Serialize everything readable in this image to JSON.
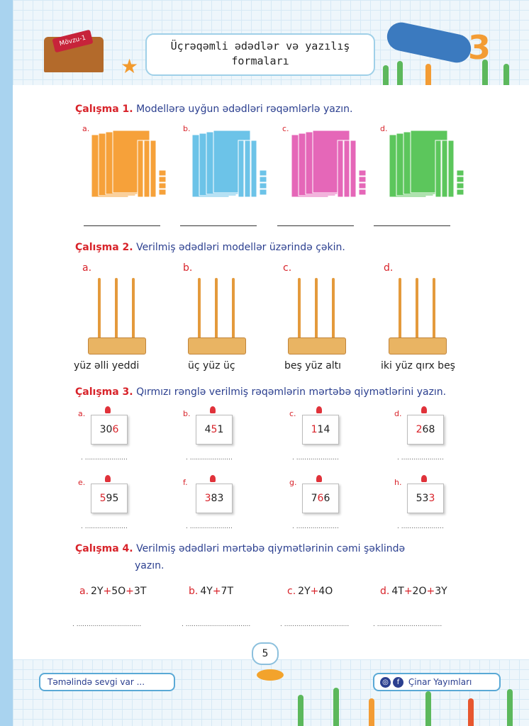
{
  "header": {
    "badge": "Mövzu-1",
    "title_line1": "Üçrəqəmli ədədlər və yazılış",
    "title_line2": "formaları"
  },
  "exercises": {
    "ex1": {
      "label": "Çalışma 1.",
      "text": "Modellərə uyğun ədədləri rəqəmlərlə yazın.",
      "items": [
        {
          "letter": "a.",
          "color": "#f6a13a"
        },
        {
          "letter": "b.",
          "color": "#6cc3e8"
        },
        {
          "letter": "c.",
          "color": "#e567b8"
        },
        {
          "letter": "d.",
          "color": "#5cc65c"
        }
      ]
    },
    "ex2": {
      "label": "Çalışma 2.",
      "text": "Verilmiş ədədləri modellər üzərində çəkin.",
      "items": [
        {
          "letter": "a.",
          "words": "yüz əlli yeddi"
        },
        {
          "letter": "b.",
          "words": "üç yüz üç"
        },
        {
          "letter": "c.",
          "words": "beş yüz altı"
        },
        {
          "letter": "d.",
          "words": "iki yüz qırx beş"
        }
      ]
    },
    "ex3": {
      "label": "Çalışma 3.",
      "text": "Qırmızı rənglə verilmiş rəqəmlərin mərtəbə qiymətlərini yazın.",
      "items": [
        {
          "letter": "a.",
          "pre": "30",
          "red": "6",
          "post": "",
          "dots": ". ....................."
        },
        {
          "letter": "b.",
          "pre": "4",
          "red": "5",
          "post": "1",
          "dots": ". ....................."
        },
        {
          "letter": "c.",
          "pre": "",
          "red": "1",
          "post": "14",
          "dots": ". ....................."
        },
        {
          "letter": "d.",
          "pre": "",
          "red": "2",
          "post": "68",
          "dots": ". ....................."
        },
        {
          "letter": "e.",
          "pre": "",
          "red": "5",
          "post": "95",
          "dots": ". ....................."
        },
        {
          "letter": "f.",
          "pre": "",
          "red": "3",
          "post": "83",
          "dots": ". ....................."
        },
        {
          "letter": "g.",
          "pre": "7",
          "red": "6",
          "post": "6",
          "dots": ". ....................."
        },
        {
          "letter": "h.",
          "pre": "53",
          "red": "3",
          "post": "",
          "dots": ". ....................."
        }
      ]
    },
    "ex4": {
      "label": "Çalışma 4.",
      "text_line1": "Verilmiş ədədləri mərtəbə qiymətlərinin cəmi şəklində",
      "text_line2": "yazın.",
      "items": [
        {
          "letter": "a.",
          "p1": "2Y",
          "op1": "+",
          "p2": "5O",
          "op2": "+",
          "p3": "3T",
          "dots": ". ................................"
        },
        {
          "letter": "b.",
          "p1": "4Y",
          "op1": "+",
          "p2": "7T",
          "op2": "",
          "p3": "",
          "dots": ". ................................"
        },
        {
          "letter": "c.",
          "p1": "2Y",
          "op1": "+",
          "p2": "4O",
          "op2": "",
          "p3": "",
          "dots": ". ................................"
        },
        {
          "letter": "d.",
          "p1": "4T",
          "op1": "+",
          "p2": "2O",
          "op2": "+",
          "p3": "3Y",
          "dots": ". ................................"
        }
      ]
    }
  },
  "footer": {
    "page_number": "5",
    "slogan": "Təməlində sevgi var ...",
    "publisher": "Çinar Yayımları",
    "icons": [
      "instagram-icon",
      "facebook-icon"
    ]
  }
}
